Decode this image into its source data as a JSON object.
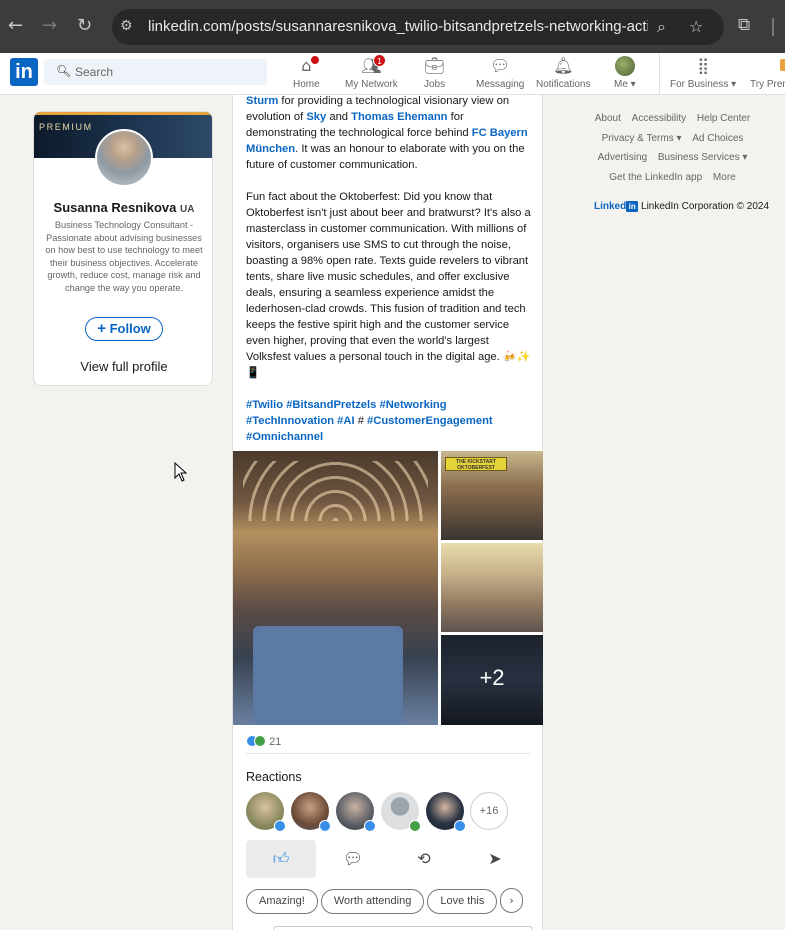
{
  "browser": {
    "url": "linkedin.com/posts/susannaresnikova_twilio-bitsandpretzels-networking-activit...",
    "back_icon": "←",
    "forward_icon": "→",
    "reload_icon": "↻"
  },
  "header": {
    "logo": "in",
    "search_placeholder": "Search",
    "nav": [
      {
        "label": "Home",
        "icon": "home-icon"
      },
      {
        "label": "My Network",
        "icon": "people-icon",
        "badge": "1"
      },
      {
        "label": "Jobs",
        "icon": "briefcase-icon"
      },
      {
        "label": "Messaging",
        "icon": "chat-icon"
      },
      {
        "label": "Notifications",
        "icon": "bell-icon"
      },
      {
        "label": "Me",
        "icon": "avatar"
      },
      {
        "label": "For Business",
        "icon": "grid-icon"
      },
      {
        "label": "Try Prem",
        "icon": "premium-icon"
      }
    ]
  },
  "profile": {
    "banner_label": "PREMIUM",
    "name": "Susanna Resnikova",
    "flag": "UA",
    "tagline": "Business Technology Consultant - Passionate about advising businesses on how best to use technology to meet their business objectives. Accelerate growth, reduce cost, manage risk and change the way you operate.",
    "follow_label": "Follow",
    "view_full_label": "View full profile"
  },
  "post": {
    "p1": {
      "a": "Sturm",
      "t1": " for providing a technological visionary view on evolution of ",
      "b": "Sky",
      "t2": " and ",
      "c": "Thomas Ehemann",
      "t3": " for demonstrating the technological force behind ",
      "d": "FC Bayern München",
      "t4": ". It was an honour to elaborate with you on the future of customer communication."
    },
    "p2": "Fun fact about the Oktoberfest: Did you know that Oktoberfest isn't just about beer and bratwurst? It's also a masterclass in customer communication. With millions of visitors, organisers use SMS to cut through the noise, boasting a 98% open rate. Texts guide revelers to vibrant tents, share live music schedules, and offer exclusive deals, ensuring a seamless experience amidst the lederhosen-clad crowds. This fusion of tradition and tech keeps the festive spirit high and the customer service even higher, proving that even the world's largest Volksfest values a personal touch in the digital age. 🍻✨📱",
    "hashtags": {
      "h1": "#Twilio",
      "h2": "#BitsandPretzels",
      "h3": "#Networking",
      "h4": "#TechInnovation",
      "h5": "#AI",
      "sep": "#",
      "h6": "#CustomerEngagement",
      "h7": "#Omnichannel"
    },
    "image_sign": "THE KICKSTART OKTOBERFEST",
    "more_images": "+2",
    "reaction_count": "21",
    "reactions_title": "Reactions",
    "more_reactors": "+16",
    "suggestions": [
      "Amazing!",
      "Worth attending",
      "Love this"
    ]
  },
  "footer": {
    "links_row1": [
      "About",
      "Accessibility",
      "Help Center"
    ],
    "links_row2": [
      "Privacy & Terms ▾",
      "Ad Choices"
    ],
    "links_row3": [
      "Advertising",
      "Business Services ▾"
    ],
    "links_row4": [
      "Get the LinkedIn app",
      "More"
    ],
    "brand": "Linked",
    "copyright": "LinkedIn Corporation © 2024"
  },
  "colors": {
    "accent": "#0a66c2",
    "badge": "#cc1016"
  }
}
